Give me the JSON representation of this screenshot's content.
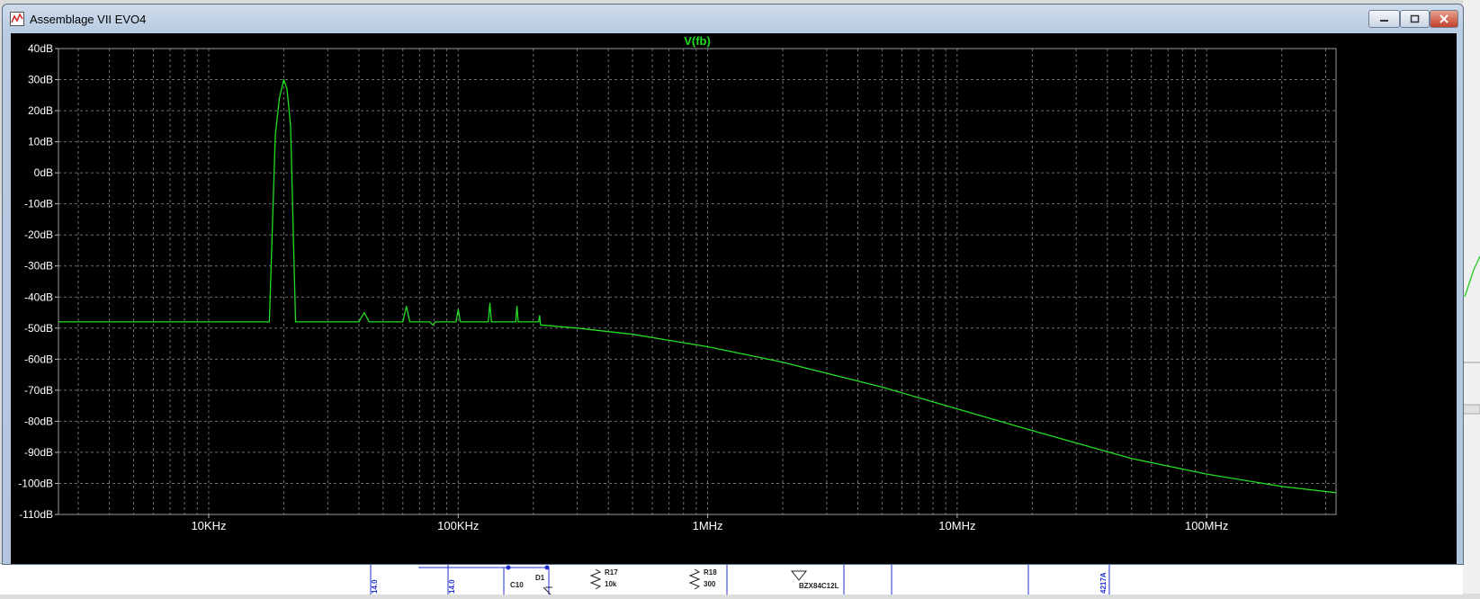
{
  "window": {
    "title": "Assemblage VII EVO4",
    "app_icon": "waveform-icon",
    "minimize_icon": "minimize-icon",
    "maximize_icon": "maximize-icon",
    "close_icon": "close-icon"
  },
  "colors": {
    "trace": "#22dd22",
    "background": "#000000",
    "grid": "#6e6e6e",
    "axis_text": "#ffffff",
    "schematic_wire": "#1e2fd6",
    "schematic_text": "#1e2fd6"
  },
  "chart_data": {
    "type": "line",
    "title": "V(fb)",
    "xscale": "log",
    "xlim": [
      2500,
      330000000
    ],
    "ylim": [
      -110,
      40
    ],
    "grid": true,
    "x_tick_labels": [
      "10KHz",
      "100KHz",
      "1MHz",
      "10MHz",
      "100MHz"
    ],
    "x_tick_values": [
      10000,
      100000,
      1000000,
      10000000,
      100000000
    ],
    "y_tick_labels": [
      "40dB",
      "30dB",
      "20dB",
      "10dB",
      "0dB",
      "-10dB",
      "-20dB",
      "-30dB",
      "-40dB",
      "-50dB",
      "-60dB",
      "-70dB",
      "-80dB",
      "-90dB",
      "-100dB",
      "-110dB"
    ],
    "y_tick_values": [
      40,
      30,
      20,
      10,
      0,
      -10,
      -20,
      -30,
      -40,
      -50,
      -60,
      -70,
      -80,
      -90,
      -100,
      -110
    ],
    "series": [
      {
        "name": "V(fb)",
        "x": [
          2500,
          17500,
          18500,
          19200,
          20000,
          20600,
          21300,
          22300,
          23200,
          40000,
          42000,
          44000,
          60000,
          62000,
          64000,
          77000,
          79000,
          81000,
          98000,
          100000,
          102000,
          132000,
          134000,
          136000,
          170000,
          172000,
          174000,
          210000,
          212000,
          214000,
          300000,
          500000,
          1000000,
          2000000,
          5000000,
          10000000,
          20000000,
          50000000,
          100000000,
          200000000,
          330000000
        ],
        "y": [
          -48,
          -48,
          12,
          24,
          30,
          27,
          15,
          -48,
          -48,
          -48,
          -45,
          -48,
          -48,
          -43,
          -48,
          -48,
          -49,
          -48,
          -48,
          -44,
          -48,
          -48,
          -42,
          -48,
          -48,
          -43,
          -48,
          -48,
          -46,
          -49,
          -50,
          -52,
          -56,
          -61,
          -69,
          -76,
          -83,
          -92,
          -97,
          -101,
          -103
        ]
      }
    ]
  },
  "schematic": {
    "labels": [
      {
        "id": "net-label-a",
        "text": "14.0"
      },
      {
        "id": "net-label-b",
        "text": "14.0"
      },
      {
        "id": "ref-c10",
        "text": "C10"
      },
      {
        "id": "ref-d1",
        "text": "D1"
      },
      {
        "id": "ref-r17",
        "text": "R17"
      },
      {
        "id": "val-r17",
        "text": "10k"
      },
      {
        "id": "ref-r18",
        "text": "R18"
      },
      {
        "id": "val-r18",
        "text": "300"
      },
      {
        "id": "val-zener",
        "text": "BZX84C12L"
      },
      {
        "id": "net-label-c",
        "text": "4217A"
      }
    ]
  }
}
